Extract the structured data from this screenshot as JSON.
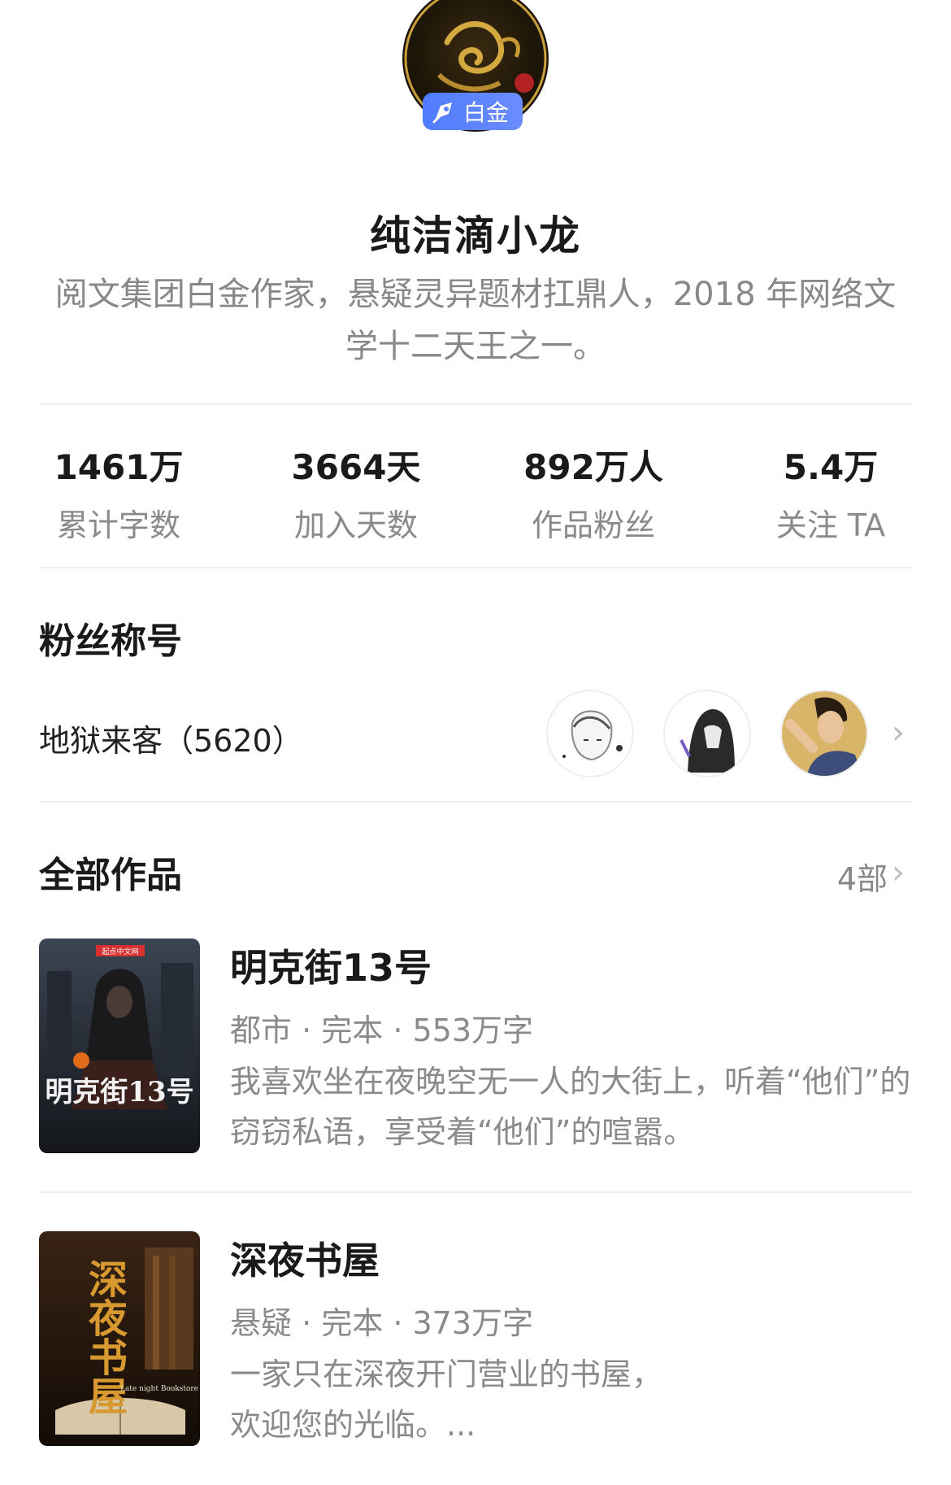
{
  "author": {
    "badge": "白金",
    "name": "纯洁滴小龙",
    "bio": "阅文集团白金作家，悬疑灵异题材扛鼎人，2018 年网络文学十二天王之一。"
  },
  "stats": [
    {
      "value": "1461万",
      "label": "累计字数"
    },
    {
      "value": "3664天",
      "label": "加入天数"
    },
    {
      "value": "892万人",
      "label": "作品粉丝"
    },
    {
      "value": "5.4万",
      "label": "关注 TA"
    }
  ],
  "fans": {
    "section_title": "粉丝称号",
    "title_name": "地狱来客（5620）",
    "chevron": "›"
  },
  "works": {
    "section_title": "全部作品",
    "count": "4部",
    "chevron": "›",
    "items": [
      {
        "title": "明克街13号",
        "meta": "都市 · 完本 · 553万字",
        "desc": "我喜欢坐在夜晚空无一人的大街上，听着“他们”的窃窃私语，享受着“他们”的喧嚣。",
        "cover_text": "明克街13号",
        "cover_logo": "起点中文网"
      },
      {
        "title": "深夜书屋",
        "meta": "悬疑 · 完本 · 373万字",
        "desc": "一家只在深夜开门营业的书屋，\n欢迎您的光临。...",
        "cover_text": "深夜书屋",
        "cover_subtitle": "Late night Bookstore"
      }
    ]
  },
  "colors": {
    "badge": "#5b82ff",
    "muted": "#8a8a8a",
    "divider": "#efefef"
  }
}
